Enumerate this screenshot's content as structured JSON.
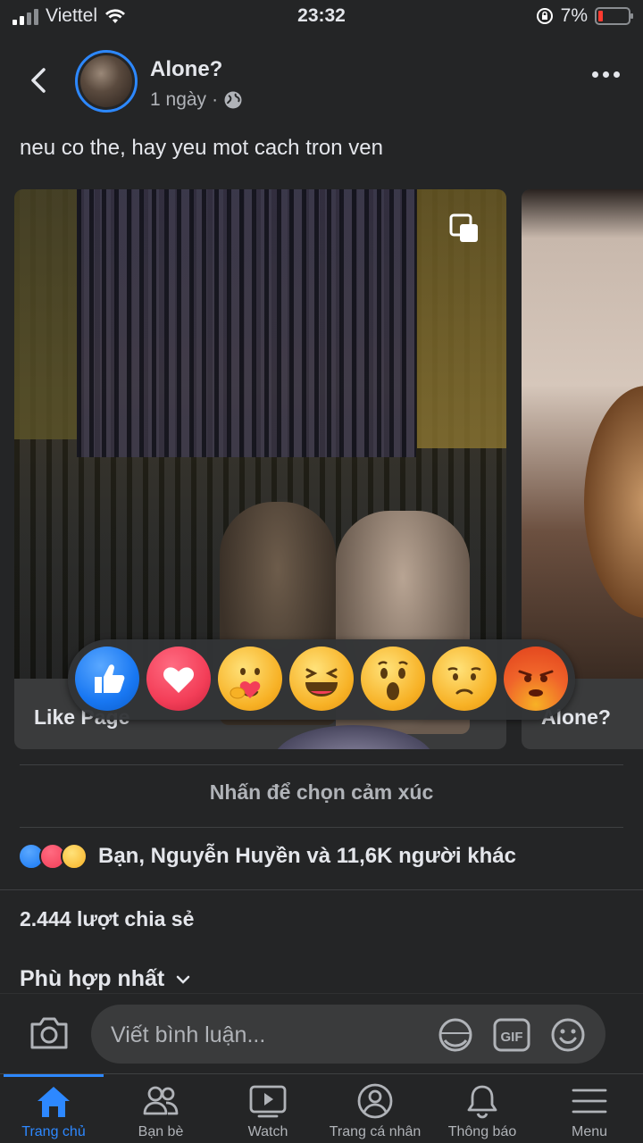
{
  "status_bar": {
    "carrier": "Viettel",
    "time": "23:32",
    "battery": "7%"
  },
  "post": {
    "author": "Alone?",
    "time": "1 ngày",
    "separator": "·",
    "caption": "neu co the, hay yeu mot cach tron ven"
  },
  "carousel": [
    {
      "label": "Like Page"
    },
    {
      "label": "Alone?"
    }
  ],
  "reactions": [
    "like",
    "love",
    "care",
    "haha",
    "wow",
    "sad",
    "angry"
  ],
  "reaction_hint": "Nhấn để chọn cảm xúc",
  "reaction_summary": "Bạn, Nguyễn Huyền và 11,6K người khác",
  "shares": "2.444 lượt chia sẻ",
  "sort_label": "Phù hợp nhất",
  "comment": {
    "placeholder": "Viết bình luận..."
  },
  "bottom_nav": [
    {
      "label": "Trang chủ",
      "icon": "home-icon",
      "active": true
    },
    {
      "label": "Bạn bè",
      "icon": "friends-icon"
    },
    {
      "label": "Watch",
      "icon": "watch-icon"
    },
    {
      "label": "Trang cá nhân",
      "icon": "profile-icon"
    },
    {
      "label": "Thông báo",
      "icon": "bell-icon"
    },
    {
      "label": "Menu",
      "icon": "menu-icon"
    }
  ],
  "colors": {
    "accent": "#2d88ff",
    "background": "#242526",
    "like": "#1877f2",
    "love": "#f33e58",
    "yellow": "#f7b125"
  }
}
